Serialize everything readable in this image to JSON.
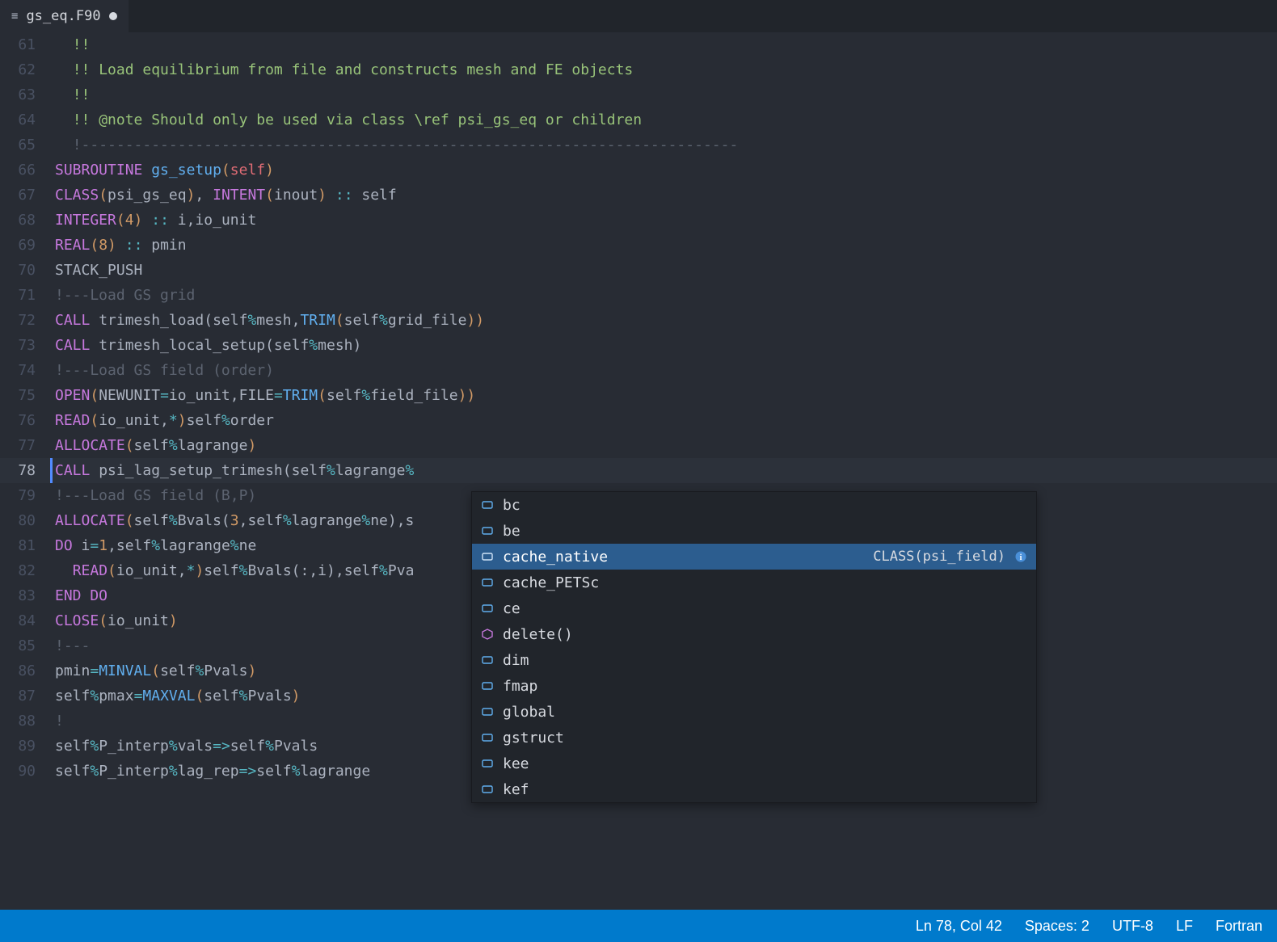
{
  "tab": {
    "filename": "gs_eq.F90",
    "dirty": true
  },
  "gutter_start": 61,
  "code_lines": [
    [
      [
        "grn",
        "!!"
      ]
    ],
    [
      [
        "grn",
        "!! Load equilibrium from file and constructs mesh and FE objects"
      ]
    ],
    [
      [
        "grn",
        "!!"
      ]
    ],
    [
      [
        "grn",
        "!! @note Should only be used via class \\ref psi_gs_eq or children"
      ]
    ],
    [
      [
        "cmt",
        "!---------------------------------------------------------------------------"
      ]
    ],
    [
      [
        "kw",
        "SUBROUTINE"
      ],
      [
        "pl",
        " "
      ],
      [
        "fn",
        "gs_setup"
      ],
      [
        "br",
        "("
      ],
      [
        "red",
        "self"
      ],
      [
        "br",
        ")"
      ]
    ],
    [
      [
        "kw",
        "CLASS"
      ],
      [
        "br",
        "("
      ],
      [
        "pl",
        "psi_gs_eq"
      ],
      [
        "br",
        ")"
      ],
      [
        "pl",
        ", "
      ],
      [
        "kw",
        "INTENT"
      ],
      [
        "br",
        "("
      ],
      [
        "pl",
        "inout"
      ],
      [
        "br",
        ")"
      ],
      [
        "pl",
        " "
      ],
      [
        "op",
        "::"
      ],
      [
        "pl",
        " self"
      ]
    ],
    [
      [
        "kw",
        "INTEGER"
      ],
      [
        "br",
        "("
      ],
      [
        "nm",
        "4"
      ],
      [
        "br",
        ")"
      ],
      [
        "pl",
        " "
      ],
      [
        "op",
        "::"
      ],
      [
        "pl",
        " i,io_unit"
      ]
    ],
    [
      [
        "kw",
        "REAL"
      ],
      [
        "br",
        "("
      ],
      [
        "nm",
        "8"
      ],
      [
        "br",
        ")"
      ],
      [
        "pl",
        " "
      ],
      [
        "op",
        "::"
      ],
      [
        "pl",
        " pmin"
      ]
    ],
    [
      [
        "pl",
        "STACK_PUSH"
      ]
    ],
    [
      [
        "cmt",
        "!---Load GS grid"
      ]
    ],
    [
      [
        "kw",
        "CALL"
      ],
      [
        "pl",
        " trimesh_load(self"
      ],
      [
        "op",
        "%"
      ],
      [
        "pl",
        "mesh,"
      ],
      [
        "fn",
        "TRIM"
      ],
      [
        "br",
        "("
      ],
      [
        "pl",
        "self"
      ],
      [
        "op",
        "%"
      ],
      [
        "pl",
        "grid_file"
      ],
      [
        "br",
        "))"
      ]
    ],
    [
      [
        "kw",
        "CALL"
      ],
      [
        "pl",
        " trimesh_local_setup(self"
      ],
      [
        "op",
        "%"
      ],
      [
        "pl",
        "mesh)"
      ]
    ],
    [
      [
        "cmt",
        "!---Load GS field (order)"
      ]
    ],
    [
      [
        "kw",
        "OPEN"
      ],
      [
        "br",
        "("
      ],
      [
        "pl",
        "NEWUNIT"
      ],
      [
        "op",
        "="
      ],
      [
        "pl",
        "io_unit,FILE"
      ],
      [
        "op",
        "="
      ],
      [
        "fn",
        "TRIM"
      ],
      [
        "br",
        "("
      ],
      [
        "pl",
        "self"
      ],
      [
        "op",
        "%"
      ],
      [
        "pl",
        "field_file"
      ],
      [
        "br",
        "))"
      ]
    ],
    [
      [
        "kw",
        "READ"
      ],
      [
        "br",
        "("
      ],
      [
        "pl",
        "io_unit,"
      ],
      [
        "op",
        "*"
      ],
      [
        "br",
        ")"
      ],
      [
        "pl",
        "self"
      ],
      [
        "op",
        "%"
      ],
      [
        "pl",
        "order"
      ]
    ],
    [
      [
        "kw",
        "ALLOCATE"
      ],
      [
        "br",
        "("
      ],
      [
        "pl",
        "self"
      ],
      [
        "op",
        "%"
      ],
      [
        "pl",
        "lagrange"
      ],
      [
        "br",
        ")"
      ]
    ],
    [
      [
        "kw",
        "CALL"
      ],
      [
        "pl",
        " psi_lag_setup_trimesh(self"
      ],
      [
        "op",
        "%"
      ],
      [
        "pl",
        "lagrange"
      ],
      [
        "op",
        "%"
      ]
    ],
    [
      [
        "cmt",
        "!---Load GS field (B,P)"
      ]
    ],
    [
      [
        "kw",
        "ALLOCATE"
      ],
      [
        "br",
        "("
      ],
      [
        "pl",
        "self"
      ],
      [
        "op",
        "%"
      ],
      [
        "pl",
        "Bvals("
      ],
      [
        "nm",
        "3"
      ],
      [
        "pl",
        ",self"
      ],
      [
        "op",
        "%"
      ],
      [
        "pl",
        "lagrange"
      ],
      [
        "op",
        "%"
      ],
      [
        "pl",
        "ne),s"
      ]
    ],
    [
      [
        "kw",
        "DO"
      ],
      [
        "pl",
        " i"
      ],
      [
        "op",
        "="
      ],
      [
        "nm",
        "1"
      ],
      [
        "pl",
        ",self"
      ],
      [
        "op",
        "%"
      ],
      [
        "pl",
        "lagrange"
      ],
      [
        "op",
        "%"
      ],
      [
        "pl",
        "ne"
      ]
    ],
    [
      [
        "pl",
        "  "
      ],
      [
        "kw",
        "READ"
      ],
      [
        "br",
        "("
      ],
      [
        "pl",
        "io_unit,"
      ],
      [
        "op",
        "*"
      ],
      [
        "br",
        ")"
      ],
      [
        "pl",
        "self"
      ],
      [
        "op",
        "%"
      ],
      [
        "pl",
        "Bvals(:,i),self"
      ],
      [
        "op",
        "%"
      ],
      [
        "pl",
        "Pva"
      ]
    ],
    [
      [
        "kw",
        "END DO"
      ]
    ],
    [
      [
        "kw",
        "CLOSE"
      ],
      [
        "br",
        "("
      ],
      [
        "pl",
        "io_unit"
      ],
      [
        "br",
        ")"
      ]
    ],
    [
      [
        "cmt",
        "!---"
      ]
    ],
    [
      [
        "pl",
        "pmin"
      ],
      [
        "op",
        "="
      ],
      [
        "fn",
        "MINVAL"
      ],
      [
        "br",
        "("
      ],
      [
        "pl",
        "self"
      ],
      [
        "op",
        "%"
      ],
      [
        "pl",
        "Pvals"
      ],
      [
        "br",
        ")"
      ]
    ],
    [
      [
        "pl",
        "self"
      ],
      [
        "op",
        "%"
      ],
      [
        "pl",
        "pmax"
      ],
      [
        "op",
        "="
      ],
      [
        "fn",
        "MAXVAL"
      ],
      [
        "br",
        "("
      ],
      [
        "pl",
        "self"
      ],
      [
        "op",
        "%"
      ],
      [
        "pl",
        "Pvals"
      ],
      [
        "br",
        ")"
      ]
    ],
    [
      [
        "cmt",
        "!"
      ]
    ],
    [
      [
        "pl",
        "self"
      ],
      [
        "op",
        "%"
      ],
      [
        "pl",
        "P_interp"
      ],
      [
        "op",
        "%"
      ],
      [
        "pl",
        "vals"
      ],
      [
        "op",
        "=>"
      ],
      [
        "pl",
        "self"
      ],
      [
        "op",
        "%"
      ],
      [
        "pl",
        "Pvals"
      ]
    ],
    [
      [
        "pl",
        "self"
      ],
      [
        "op",
        "%"
      ],
      [
        "pl",
        "P_interp"
      ],
      [
        "op",
        "%"
      ],
      [
        "pl",
        "lag_rep"
      ],
      [
        "op",
        "=>"
      ],
      [
        "pl",
        "self"
      ],
      [
        "op",
        "%"
      ],
      [
        "pl",
        "lagrange"
      ]
    ]
  ],
  "current_line_index": 17,
  "indent_first_5": "  ",
  "indent_rest": "",
  "autocomplete": {
    "selected_index": 2,
    "items": [
      {
        "icon": "var",
        "label": "bc",
        "detail": ""
      },
      {
        "icon": "var",
        "label": "be",
        "detail": ""
      },
      {
        "icon": "var",
        "label": "cache_native",
        "detail": "CLASS(psi_field)"
      },
      {
        "icon": "var",
        "label": "cache_PETSc",
        "detail": ""
      },
      {
        "icon": "var",
        "label": "ce",
        "detail": ""
      },
      {
        "icon": "method",
        "label": "delete()",
        "detail": ""
      },
      {
        "icon": "var",
        "label": "dim",
        "detail": ""
      },
      {
        "icon": "var",
        "label": "fmap",
        "detail": ""
      },
      {
        "icon": "var",
        "label": "global",
        "detail": ""
      },
      {
        "icon": "var",
        "label": "gstruct",
        "detail": ""
      },
      {
        "icon": "var",
        "label": "kee",
        "detail": ""
      },
      {
        "icon": "var",
        "label": "kef",
        "detail": ""
      }
    ]
  },
  "status": {
    "cursor": "Ln 78, Col 42",
    "spaces": "Spaces: 2",
    "encoding": "UTF-8",
    "eol": "LF",
    "language": "Fortran"
  }
}
